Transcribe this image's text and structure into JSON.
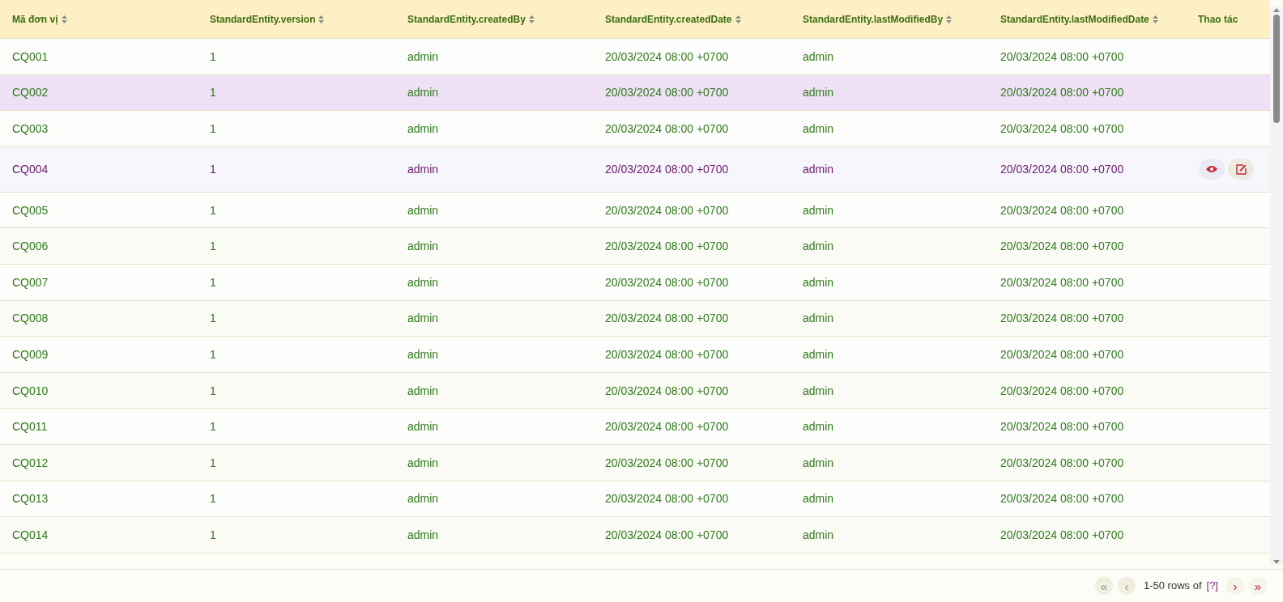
{
  "table": {
    "columns": [
      {
        "label": "Mã đơn vị",
        "sortable": true
      },
      {
        "label": "StandardEntity.version",
        "sortable": true
      },
      {
        "label": "StandardEntity.createdBy",
        "sortable": true
      },
      {
        "label": "StandardEntity.createdDate",
        "sortable": true
      },
      {
        "label": "StandardEntity.lastModifiedBy",
        "sortable": true
      },
      {
        "label": "StandardEntity.lastModifiedDate",
        "sortable": true
      },
      {
        "label": "Thao tác",
        "sortable": false
      }
    ],
    "rows": [
      {
        "cells": [
          "CQ001",
          "1",
          "admin",
          "20/03/2024 08:00 +0700",
          "admin",
          "20/03/2024 08:00 +0700"
        ],
        "selected": false,
        "hovered": false
      },
      {
        "cells": [
          "CQ002",
          "1",
          "admin",
          "20/03/2024 08:00 +0700",
          "admin",
          "20/03/2024 08:00 +0700"
        ],
        "selected": true,
        "hovered": false
      },
      {
        "cells": [
          "CQ003",
          "1",
          "admin",
          "20/03/2024 08:00 +0700",
          "admin",
          "20/03/2024 08:00 +0700"
        ],
        "selected": false,
        "hovered": false
      },
      {
        "cells": [
          "CQ004",
          "1",
          "admin",
          "20/03/2024 08:00 +0700",
          "admin",
          "20/03/2024 08:00 +0700"
        ],
        "selected": false,
        "hovered": true
      },
      {
        "cells": [
          "CQ005",
          "1",
          "admin",
          "20/03/2024 08:00 +0700",
          "admin",
          "20/03/2024 08:00 +0700"
        ],
        "selected": false,
        "hovered": false
      },
      {
        "cells": [
          "CQ006",
          "1",
          "admin",
          "20/03/2024 08:00 +0700",
          "admin",
          "20/03/2024 08:00 +0700"
        ],
        "selected": false,
        "hovered": false
      },
      {
        "cells": [
          "CQ007",
          "1",
          "admin",
          "20/03/2024 08:00 +0700",
          "admin",
          "20/03/2024 08:00 +0700"
        ],
        "selected": false,
        "hovered": false
      },
      {
        "cells": [
          "CQ008",
          "1",
          "admin",
          "20/03/2024 08:00 +0700",
          "admin",
          "20/03/2024 08:00 +0700"
        ],
        "selected": false,
        "hovered": false
      },
      {
        "cells": [
          "CQ009",
          "1",
          "admin",
          "20/03/2024 08:00 +0700",
          "admin",
          "20/03/2024 08:00 +0700"
        ],
        "selected": false,
        "hovered": false
      },
      {
        "cells": [
          "CQ010",
          "1",
          "admin",
          "20/03/2024 08:00 +0700",
          "admin",
          "20/03/2024 08:00 +0700"
        ],
        "selected": false,
        "hovered": false
      },
      {
        "cells": [
          "CQ011",
          "1",
          "admin",
          "20/03/2024 08:00 +0700",
          "admin",
          "20/03/2024 08:00 +0700"
        ],
        "selected": false,
        "hovered": false
      },
      {
        "cells": [
          "CQ012",
          "1",
          "admin",
          "20/03/2024 08:00 +0700",
          "admin",
          "20/03/2024 08:00 +0700"
        ],
        "selected": false,
        "hovered": false
      },
      {
        "cells": [
          "CQ013",
          "1",
          "admin",
          "20/03/2024 08:00 +0700",
          "admin",
          "20/03/2024 08:00 +0700"
        ],
        "selected": false,
        "hovered": false
      },
      {
        "cells": [
          "CQ014",
          "1",
          "admin",
          "20/03/2024 08:00 +0700",
          "admin",
          "20/03/2024 08:00 +0700"
        ],
        "selected": false,
        "hovered": false
      }
    ]
  },
  "pagination": {
    "first": {
      "text": "«",
      "disabled": true
    },
    "prev": {
      "text": "‹",
      "disabled": true
    },
    "range": "1-50 rows of",
    "total": "[?]",
    "next": {
      "text": "›",
      "disabled": false
    },
    "last": {
      "text": "»",
      "disabled": false
    }
  }
}
